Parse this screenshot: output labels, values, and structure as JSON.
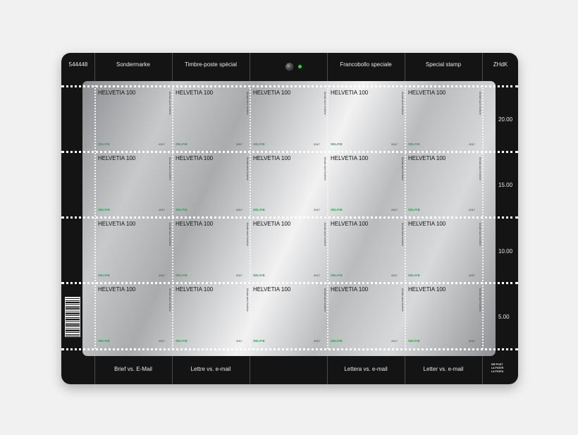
{
  "sheet": {
    "serial": "544448",
    "brand": "ZHdK",
    "header_labels": [
      "Sondermarke",
      "Timbre-poste spécial",
      "Francobollo speciale",
      "Special stamp"
    ],
    "footer_labels": [
      "Brief vs. E-Mail",
      "Lettre vs. e-mail",
      "Lettera vs. e-mail",
      "Letter vs. e-mail"
    ],
    "prices": [
      "20.00",
      "15.00",
      "10.00",
      "5.00"
    ],
    "logo_lines": [
      "DIE POST",
      "LA POSTE",
      "LA POSTA"
    ]
  },
  "stamp": {
    "title": "HELVETIA 100",
    "label": "SELFIE",
    "year": "2017",
    "side_text": "Monde sans frontière",
    "rows": 4,
    "cols": 5
  },
  "colors": {
    "sheet": "#141414",
    "perforation": "#ffffff",
    "selfie_green": "#1fa04a",
    "led": "#2fd04c"
  }
}
